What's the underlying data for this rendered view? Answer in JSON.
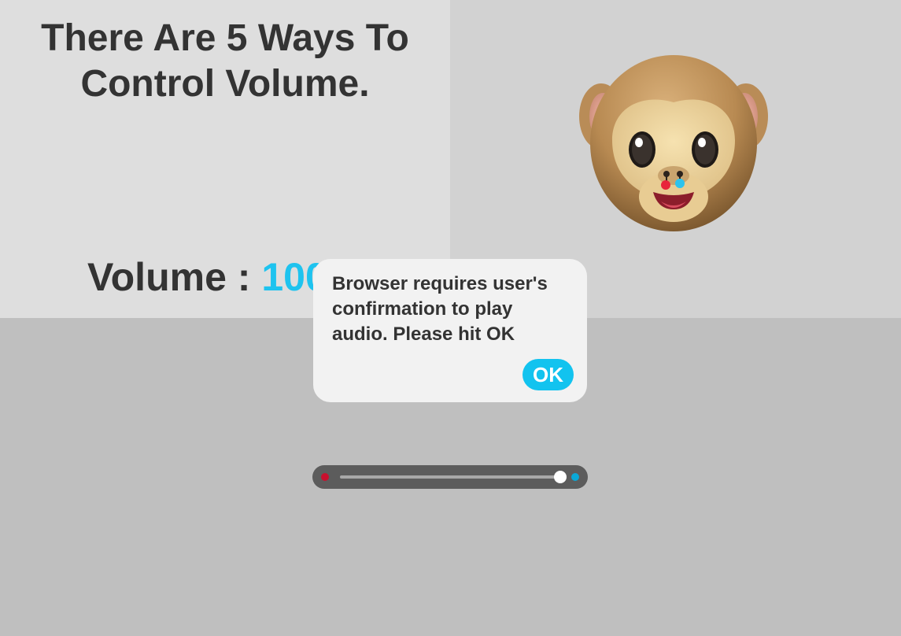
{
  "headline": {
    "line1": "There Are 5 Ways To",
    "line2": "Control Volume."
  },
  "volume": {
    "label": "Volume : ",
    "value": "100"
  },
  "dialog": {
    "message": "Browser requires user's confirmation to play audio. Please hit OK",
    "ok_label": "OK"
  },
  "slider": {
    "level": 1.0,
    "min_color": "#c8102e",
    "max_color": "#0aa8d6"
  },
  "icons": {
    "mascot": "monkey-face-icon"
  },
  "colors": {
    "accent": "#1ec3ef",
    "text": "#333333",
    "dialog_bg": "#f2f2f2"
  }
}
